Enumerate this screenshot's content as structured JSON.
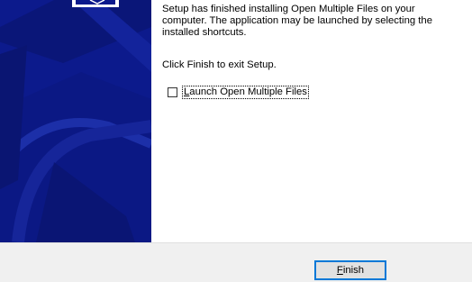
{
  "wizard": {
    "finished_message": "Setup has finished installing Open Multiple Files on your computer. The application may be launched by selecting the installed shortcuts.",
    "exit_instruction": "Click Finish to exit Setup.",
    "launch_checkbox": {
      "label": "Launch Open Multiple Files",
      "checked": false
    },
    "finish_button_label": "Finish"
  },
  "colors": {
    "sidebar_background": "#0c1a8c",
    "button_border": "#0078d7",
    "footer_background": "#f0f0f0"
  }
}
